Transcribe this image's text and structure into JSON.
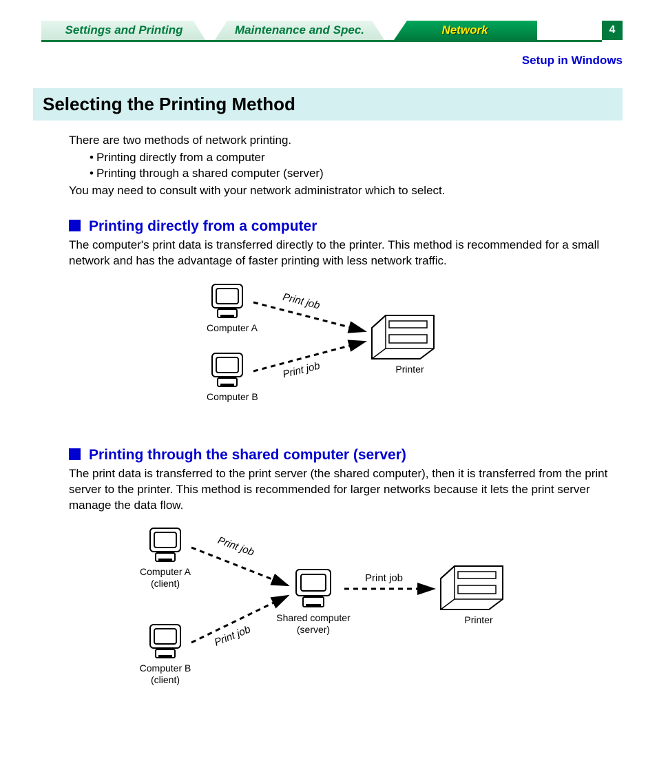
{
  "tabs": {
    "tab1": "Settings and Printing",
    "tab2": "Maintenance and Spec.",
    "tab3": "Network"
  },
  "page_number": "4",
  "setup_link": "Setup in Windows",
  "title": "Selecting the Printing Method",
  "intro_line": "There are two methods of network printing.",
  "bullet1": "Printing directly from a computer",
  "bullet2": "Printing through a shared computer (server)",
  "intro_tail": "You may need to consult with your network administrator which to select.",
  "section1": {
    "heading": "Printing directly from a computer",
    "body": "The computer's print data is transferred directly to the printer. This method is recommended for a small network and has the advantage of faster printing with less network traffic.",
    "computer_a": "Computer A",
    "computer_b": "Computer B",
    "printer": "Printer",
    "job_a": "Print job",
    "job_b": "Print job"
  },
  "section2": {
    "heading": "Printing through the shared computer (server)",
    "body": "The print data is transferred to the print server (the shared computer), then it is transferred from the print server to the printer. This method is recommended for larger networks because it lets the print server manage the data flow.",
    "computer_a": "Computer A (client)",
    "computer_b": "Computer B (client)",
    "server": "Shared computer (server)",
    "printer": "Printer",
    "job_a": "Print job",
    "job_b": "Print job",
    "job_server": "Print job"
  }
}
